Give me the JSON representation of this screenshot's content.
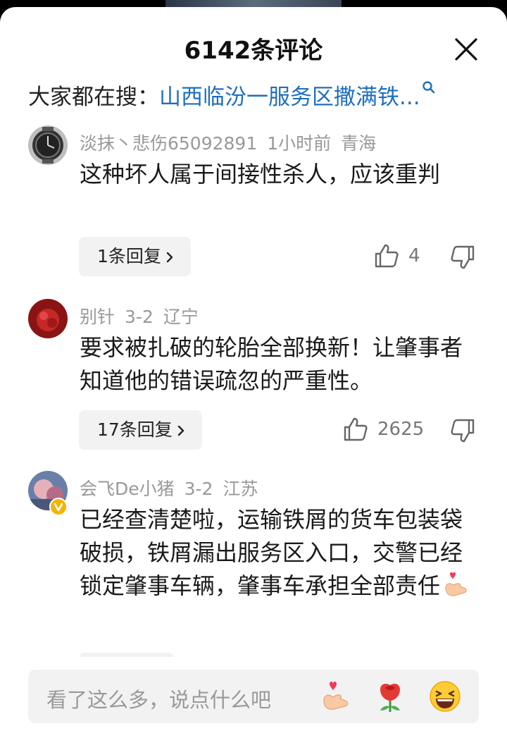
{
  "header": {
    "title": "6142条评论"
  },
  "search": {
    "prefix": "大家都在搜：",
    "query": "山西临汾一服务区撒满铁..."
  },
  "comments": [
    {
      "username": "淡抹丶悲伤65092891",
      "time": "1小时前",
      "location": "青海",
      "text": "这种坏人属于间接性杀人，应该重判",
      "replies": "1条回复",
      "likes": "4"
    },
    {
      "username": "别针",
      "time": "3-2",
      "location": "辽宁",
      "text": "要求被扎破的轮胎全部换新！让肇事者知道他的错误疏忽的严重性。",
      "replies": "17条回复",
      "likes": "2625"
    },
    {
      "username": "会飞De小猪",
      "time": "3-2",
      "location": "江苏",
      "text": "已经查清楚啦，运输铁屑的货车包装袋破损，铁屑漏出服务区入口，交警已经锁定肇事车辆，肇事车承担全部责任"
    }
  ],
  "input": {
    "placeholder": "看了这么多，说点什么吧"
  },
  "icons": [
    "close-icon",
    "search-icon",
    "chevron-right-icon",
    "thumb-up-icon",
    "thumb-down-icon",
    "heart-hand-emoji-icon",
    "rose-emoji-icon",
    "laughing-emoji-icon",
    "verified-badge-icon"
  ],
  "colors": {
    "link": "#1e6fbf",
    "meta": "#999999",
    "background": "#ffffff"
  }
}
